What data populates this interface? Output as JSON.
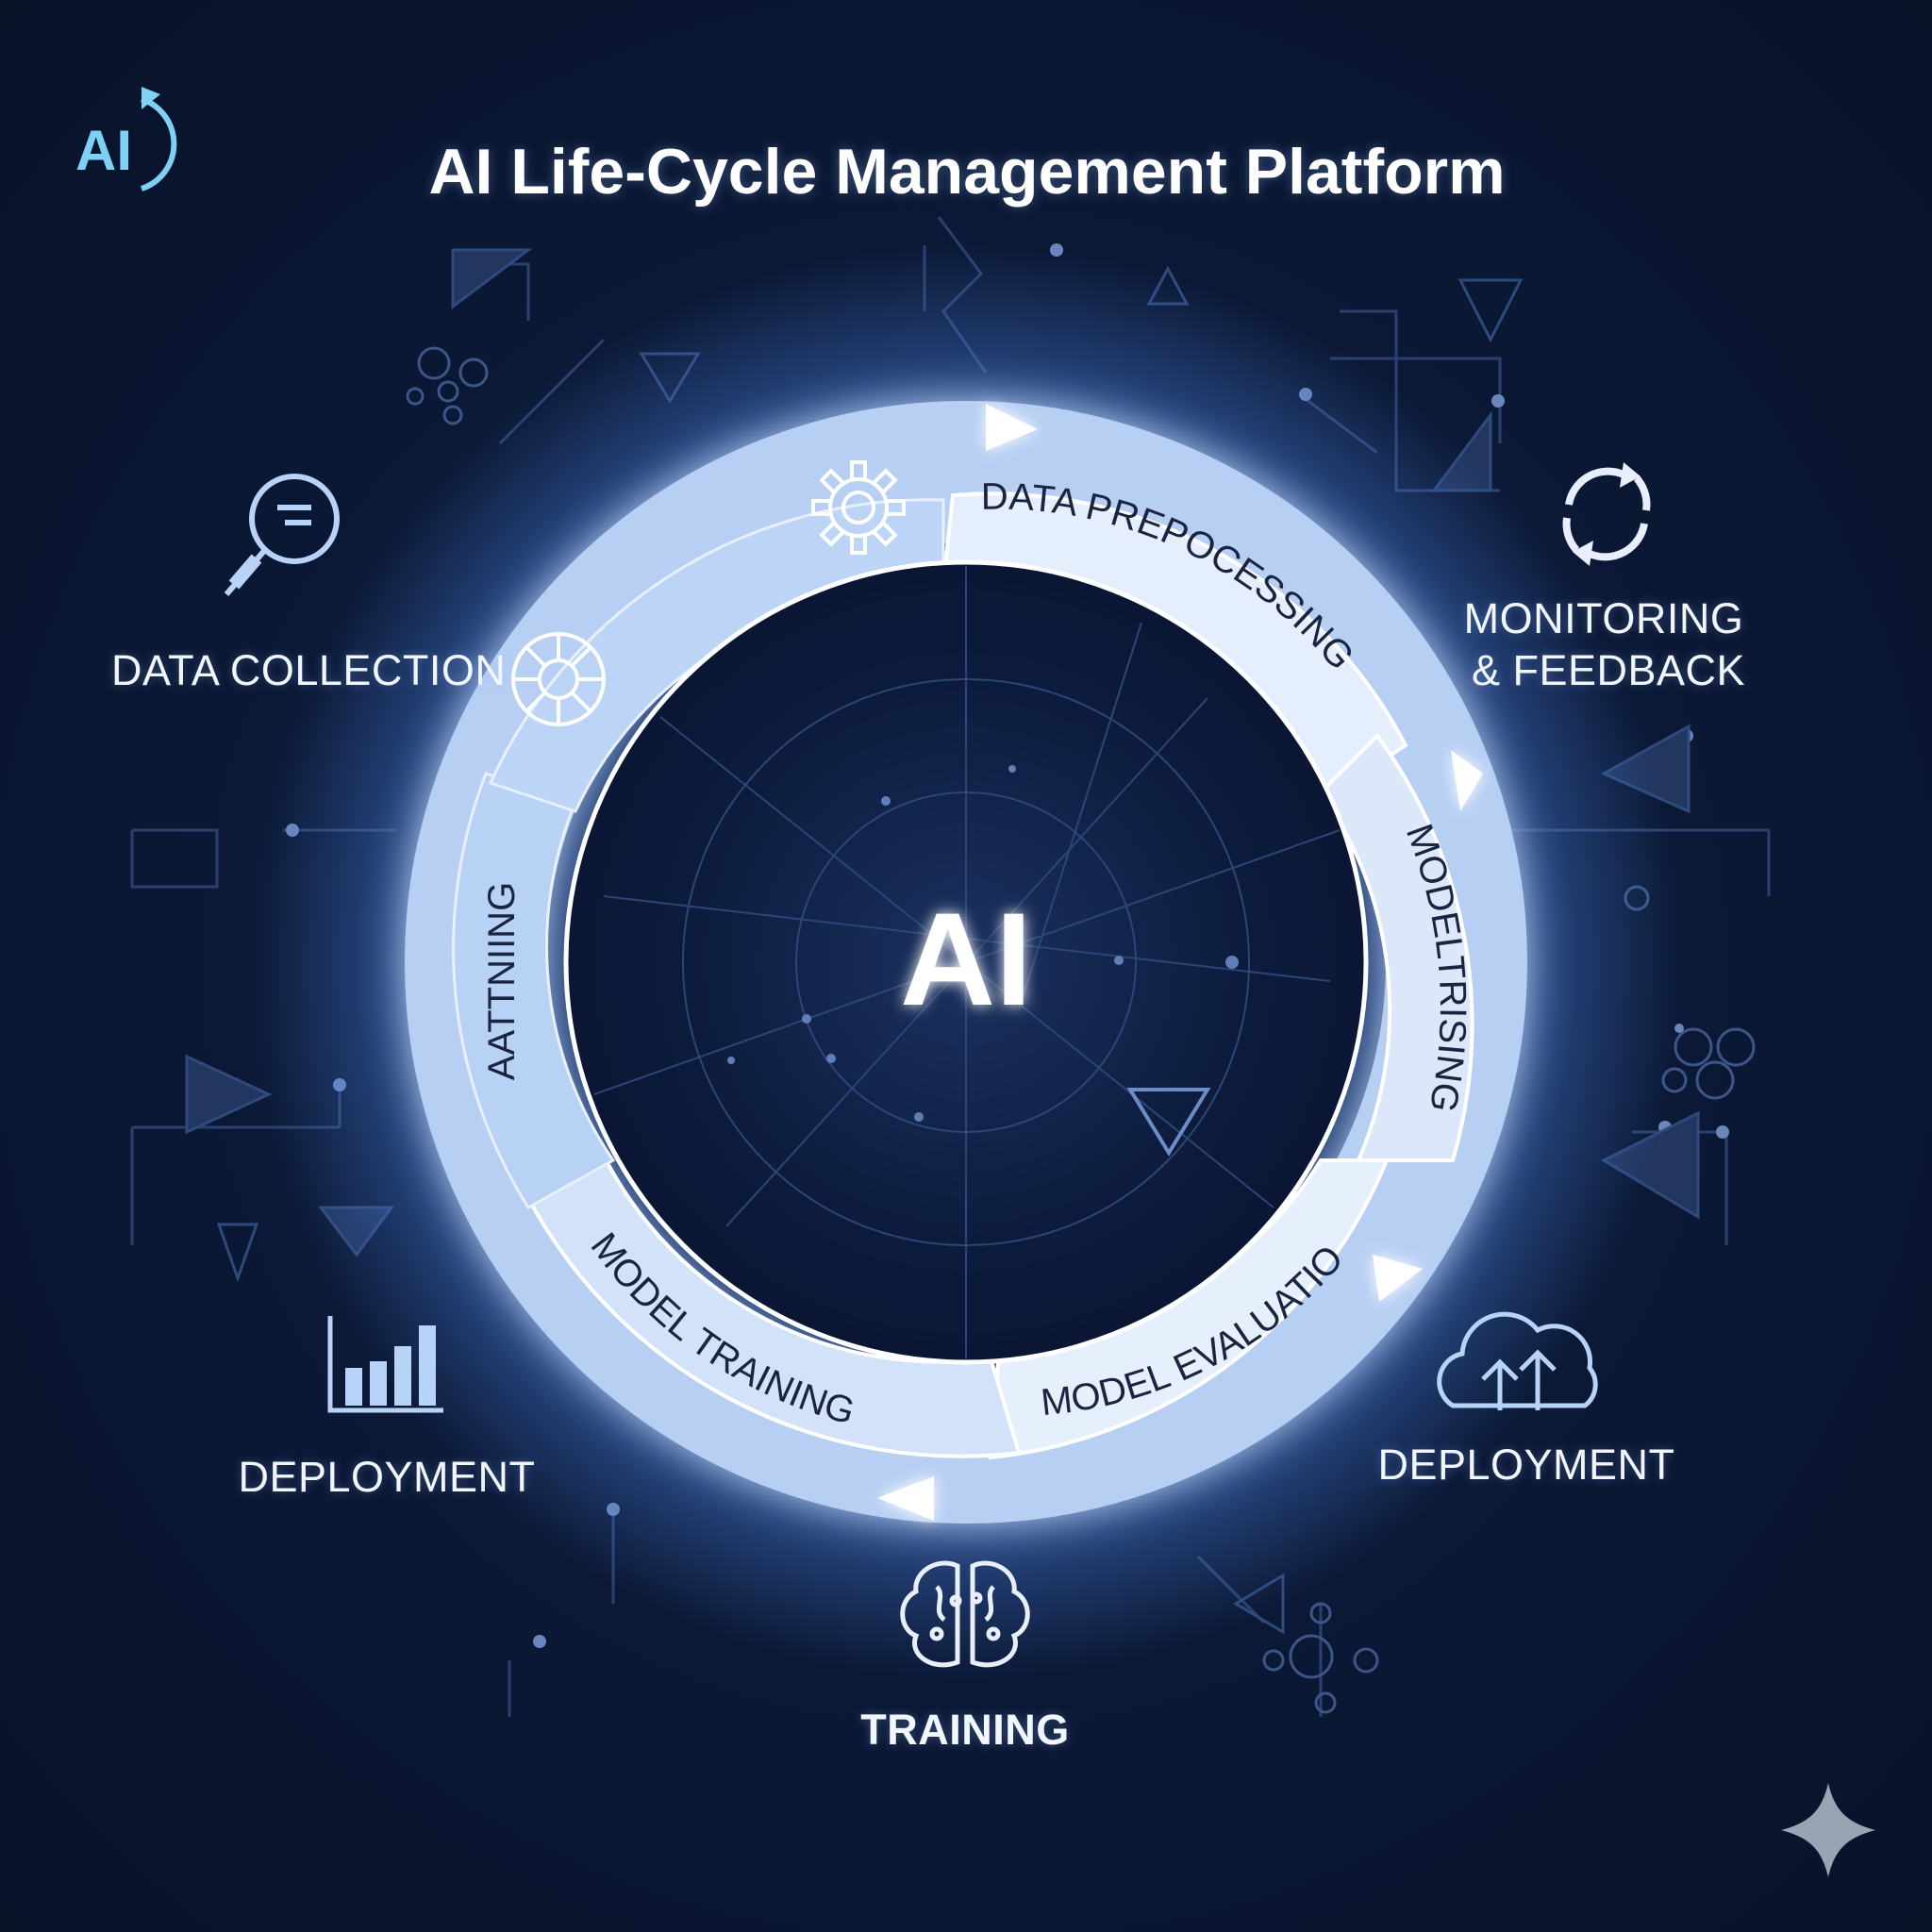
{
  "title": "AI Life-Cycle Management Platform",
  "logo_text": "AI",
  "center_text": "AI",
  "ring_segments": [
    {
      "label": "DATA PREPOCESSING"
    },
    {
      "label": "MODELTRISING"
    },
    {
      "label": "MODEL EVALUATION"
    },
    {
      "label": "MODEL TRAINING"
    },
    {
      "label": "AATTNIING"
    }
  ],
  "outer_items": {
    "data_collection": {
      "label": "DATA COLLECTION",
      "icon": "magnifier-icon"
    },
    "monitoring": {
      "label_line1": "MONITORING",
      "label_line2": "& FEEDBACK",
      "icon": "refresh-cycle-icon"
    },
    "deployment_left": {
      "label": "DEPLOYMENT",
      "icon": "bar-chart-icon"
    },
    "deployment_right": {
      "label": "DEPLOYMENT",
      "icon": "cloud-upload-icon"
    },
    "training": {
      "label": "TRAINING",
      "icon": "brain-icon"
    }
  },
  "colors": {
    "background": "#0c1a38",
    "ring_light": "#e6effc",
    "ring_blue": "#b8d2f5",
    "glow": "#7fb0ff",
    "line": "#3d5688",
    "text": "#f2f6ff"
  }
}
